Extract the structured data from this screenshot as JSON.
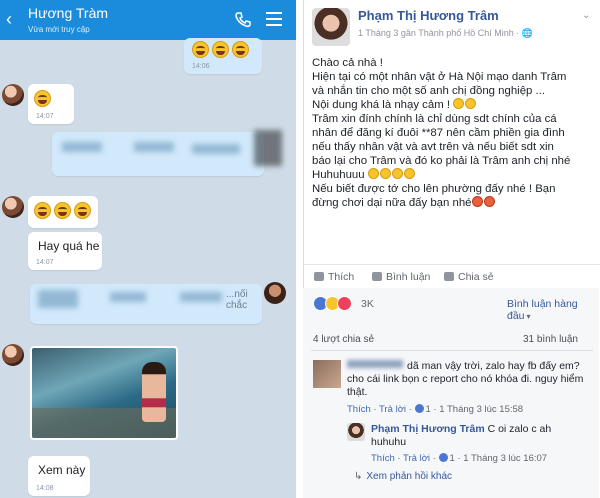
{
  "chat": {
    "contact_name": "Hương Tràm",
    "contact_status": "Vừa mới truy cập",
    "messages": [
      {
        "from": "me",
        "time": "14:06",
        "emoji_count": 3
      },
      {
        "from": "them",
        "time": "14:07",
        "emoji_count": 1
      },
      {
        "from": "them",
        "time": "14:07",
        "emoji_count": 3
      },
      {
        "from": "them",
        "text": "Hay quá he",
        "time": "14:07"
      },
      {
        "from": "me",
        "text": "...nối chắc"
      },
      {
        "from": "them",
        "text": "Xem này",
        "time": "14:08"
      }
    ]
  },
  "post": {
    "author": "Phạm Thị Hương Trâm",
    "meta": "1 Tháng 3 gần Thành phố Hồ Chí Minh · 🌐",
    "lines": [
      "Chào cả nhà !",
      "Hiện tại có một nhân vật ở Hà Nội mạo danh Trâm",
      "và nhắn tin cho một số anh chị đồng nghiệp ...",
      "Nội dung khá là nhạy cảm !",
      "Trâm xin đính chính là chỉ dùng sdt chính của cá",
      "nhân để đăng kí đuôi **87 nên cầm phiền gia đình",
      "nếu thấy nhân vật và avt trên và nếu biết sdt xin",
      "báo lại cho Trâm và đó ko phải là Trâm anh chị nhé",
      "Huhuhuuu",
      "Nếu biết được tớ cho lên phường đấy nhé ! Bạn",
      "đừng chơi dại nữa đấy bạn nhé"
    ],
    "actions": {
      "like": "Thích",
      "comment": "Bình luận",
      "share": "Chia sẻ"
    },
    "reactions_count": "3K",
    "sort_label": "Bình luận hàng đầu",
    "shares": "4 lượt chia sẻ",
    "comments_count": "31 bình luận"
  },
  "comments": [
    {
      "text_line1": "dã man vậy trời, zalo hay fb đấy em?",
      "text_line2": "cho cái link bọn c report cho nó khóa đi. nguy hiểm",
      "text_line3": "thật.",
      "like": "Thích",
      "reply": "Trả lời",
      "likes": "1",
      "time": "1 Tháng 3 lúc 15:58"
    },
    {
      "author": "Phạm Thị Hương Trâm",
      "text_line1": "C oi zalo c ah",
      "text_line2": "huhuhu",
      "like": "Thích",
      "reply": "Trả lời",
      "likes": "1",
      "time": "1 Tháng 3 lúc 16:07"
    }
  ],
  "more_replies": "Xem phản hồi khác",
  "colors": {
    "zalo_blue": "#1a8cdb",
    "fb_link": "#365899"
  }
}
